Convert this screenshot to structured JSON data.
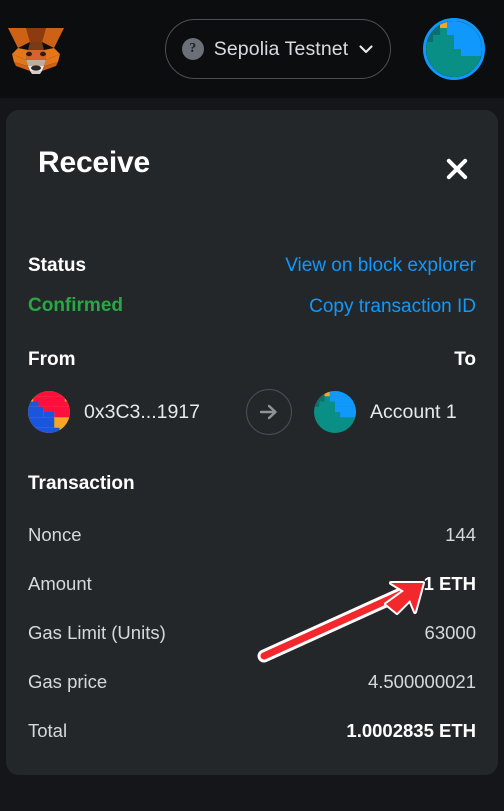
{
  "topbar": {
    "logo_icon": "metamask-fox-logo",
    "network": {
      "info_icon": "question-mark-icon",
      "name": "Sepolia Testnet",
      "chevron_icon": "chevron-down-icon"
    },
    "account_avatar_icon": "account-blockie-avatar"
  },
  "modal": {
    "title": "Receive",
    "close_icon": "close-icon",
    "status": {
      "label": "Status",
      "value": "Confirmed",
      "value_color": "#28a745"
    },
    "links": {
      "explorer": "View on block explorer",
      "copy": "Copy transaction ID",
      "color": "#1098fc"
    },
    "transfer": {
      "from_label": "From",
      "to_label": "To",
      "from_address": "0x3C3...1917",
      "to_account": "Account 1",
      "arrow_icon": "arrow-right-icon",
      "from_blockie_icon": "sender-blockie-avatar",
      "to_blockie_icon": "recipient-blockie-avatar"
    },
    "transaction": {
      "title": "Transaction",
      "rows": [
        {
          "key": "Nonce",
          "value": "144",
          "strong": false
        },
        {
          "key": "Amount",
          "value": "1 ETH",
          "strong": true
        },
        {
          "key": "Gas Limit (Units)",
          "value": "63000",
          "strong": false
        },
        {
          "key": "Gas price",
          "value": "4.500000021",
          "strong": false
        },
        {
          "key": "Total",
          "value": "1.0002835 ETH",
          "strong": true
        }
      ]
    }
  },
  "annotation": {
    "arrow_icon": "red-pointer-arrow",
    "color": "#f3282d",
    "points_at": "1 ETH"
  }
}
